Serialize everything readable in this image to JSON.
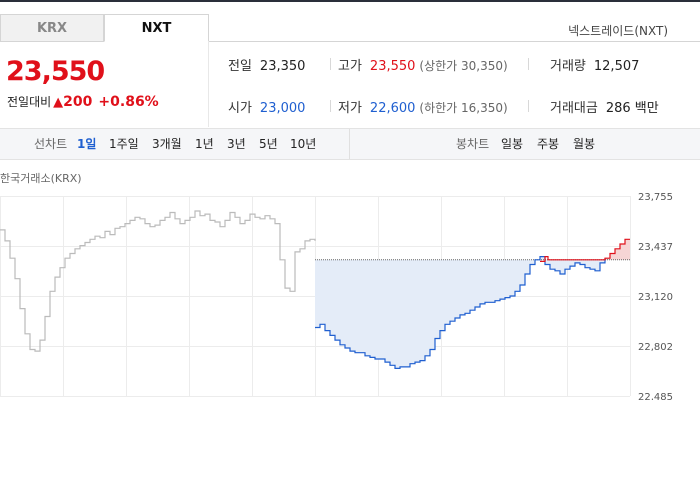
{
  "tabs": [
    {
      "label": "KRX",
      "active": false
    },
    {
      "label": "NXT",
      "active": true
    }
  ],
  "exchange_label": "넥스트레이드(NXT)",
  "price": {
    "current": "23,550",
    "change_label": "전일대비",
    "change_arrow": "▲",
    "change_amount": "200",
    "change_percent": "+0.86%"
  },
  "stats": {
    "prev_close": {
      "label": "전일",
      "value": "23,350"
    },
    "high": {
      "label": "고가",
      "value": "23,550",
      "sub": "(상한가 30,350)"
    },
    "volume": {
      "label": "거래량",
      "value": "12,507"
    },
    "open": {
      "label": "시가",
      "value": "23,000"
    },
    "low": {
      "label": "저가",
      "value": "22,600",
      "sub": "(하한가 16,350)"
    },
    "trade_value": {
      "label": "거래대금",
      "value": "286 백만"
    }
  },
  "period_bar": {
    "line_label": "선차트",
    "line_periods": [
      "1일",
      "1주일",
      "3개월",
      "1년",
      "3년",
      "5년",
      "10년"
    ],
    "active_period": "1일",
    "candle_label": "봉차트",
    "candle_periods": [
      "일봉",
      "주봉",
      "월봉"
    ]
  },
  "chart_title": "한국거래소(KRX)",
  "colors": {
    "red": "#e0101a",
    "blue": "#1f5fd0",
    "gray_line": "#bbbbbb"
  },
  "chart_data": {
    "type": "line",
    "ylim": [
      22485,
      23755
    ],
    "yticks": [
      "23,755",
      "23,437",
      "23,120",
      "22,802",
      "22,485"
    ],
    "ytick_values": [
      23755,
      23437,
      23120,
      22802,
      22485
    ],
    "reference": 23350,
    "series": [
      {
        "x": [
          0,
          5,
          10,
          15,
          20,
          25,
          30,
          35,
          40,
          45,
          50,
          55,
          60,
          65,
          70,
          75,
          80,
          85,
          90,
          95,
          100,
          105,
          110,
          115,
          120,
          125,
          130,
          135,
          140,
          145,
          150,
          155,
          160,
          165,
          170,
          175,
          180,
          185,
          190,
          195,
          200,
          205,
          210,
          215,
          220,
          225,
          230,
          235,
          240,
          245,
          250,
          255,
          260,
          265,
          270,
          275,
          280,
          285,
          290,
          295,
          300,
          305,
          310,
          315
        ],
        "y": [
          23540,
          23470,
          23360,
          23230,
          23040,
          22880,
          22780,
          22770,
          22840,
          22990,
          23150,
          23240,
          23300,
          23360,
          23390,
          23420,
          23440,
          23460,
          23480,
          23500,
          23490,
          23530,
          23510,
          23550,
          23560,
          23580,
          23600,
          23620,
          23610,
          23580,
          23560,
          23570,
          23600,
          23620,
          23650,
          23610,
          23580,
          23600,
          23620,
          23660,
          23630,
          23640,
          23600,
          23590,
          23560,
          23600,
          23650,
          23620,
          23580,
          23600,
          23640,
          23620,
          23610,
          23630,
          23610,
          23580,
          23350,
          23170,
          23150,
          23400,
          23420,
          23470,
          23480,
          23470
        ]
      },
      {
        "x": [
          315,
          320,
          325,
          330,
          335,
          340,
          345,
          350,
          355,
          360,
          365,
          370,
          375,
          380,
          385,
          390,
          395,
          400,
          405,
          410,
          415,
          420,
          425,
          430,
          435,
          440,
          445,
          450,
          455,
          460,
          465,
          470,
          475,
          480,
          485,
          490,
          495,
          500,
          505,
          510,
          515,
          520,
          525,
          530,
          535,
          540,
          545,
          550,
          555,
          560,
          565,
          570,
          575,
          580,
          585,
          590,
          595,
          600,
          605
        ],
        "y": [
          22920,
          22940,
          22900,
          22870,
          22840,
          22810,
          22790,
          22770,
          22760,
          22760,
          22740,
          22730,
          22720,
          22720,
          22700,
          22680,
          22660,
          22670,
          22670,
          22690,
          22700,
          22710,
          22740,
          22780,
          22850,
          22900,
          22940,
          22960,
          22980,
          23000,
          23010,
          23030,
          23050,
          23070,
          23080,
          23080,
          23090,
          23100,
          23110,
          23120,
          23150,
          23190,
          23260,
          23320,
          23350,
          23370,
          23320,
          23290,
          23280,
          23260,
          23290,
          23310,
          23330,
          23320,
          23300,
          23290,
          23280,
          23330,
          23360
        ]
      },
      {
        "x": [
          540,
          545,
          548,
          605,
          610,
          615,
          620,
          625,
          630
        ],
        "y": [
          23340,
          23370,
          23350,
          23360,
          23390,
          23420,
          23450,
          23480,
          23480
        ]
      }
    ]
  }
}
